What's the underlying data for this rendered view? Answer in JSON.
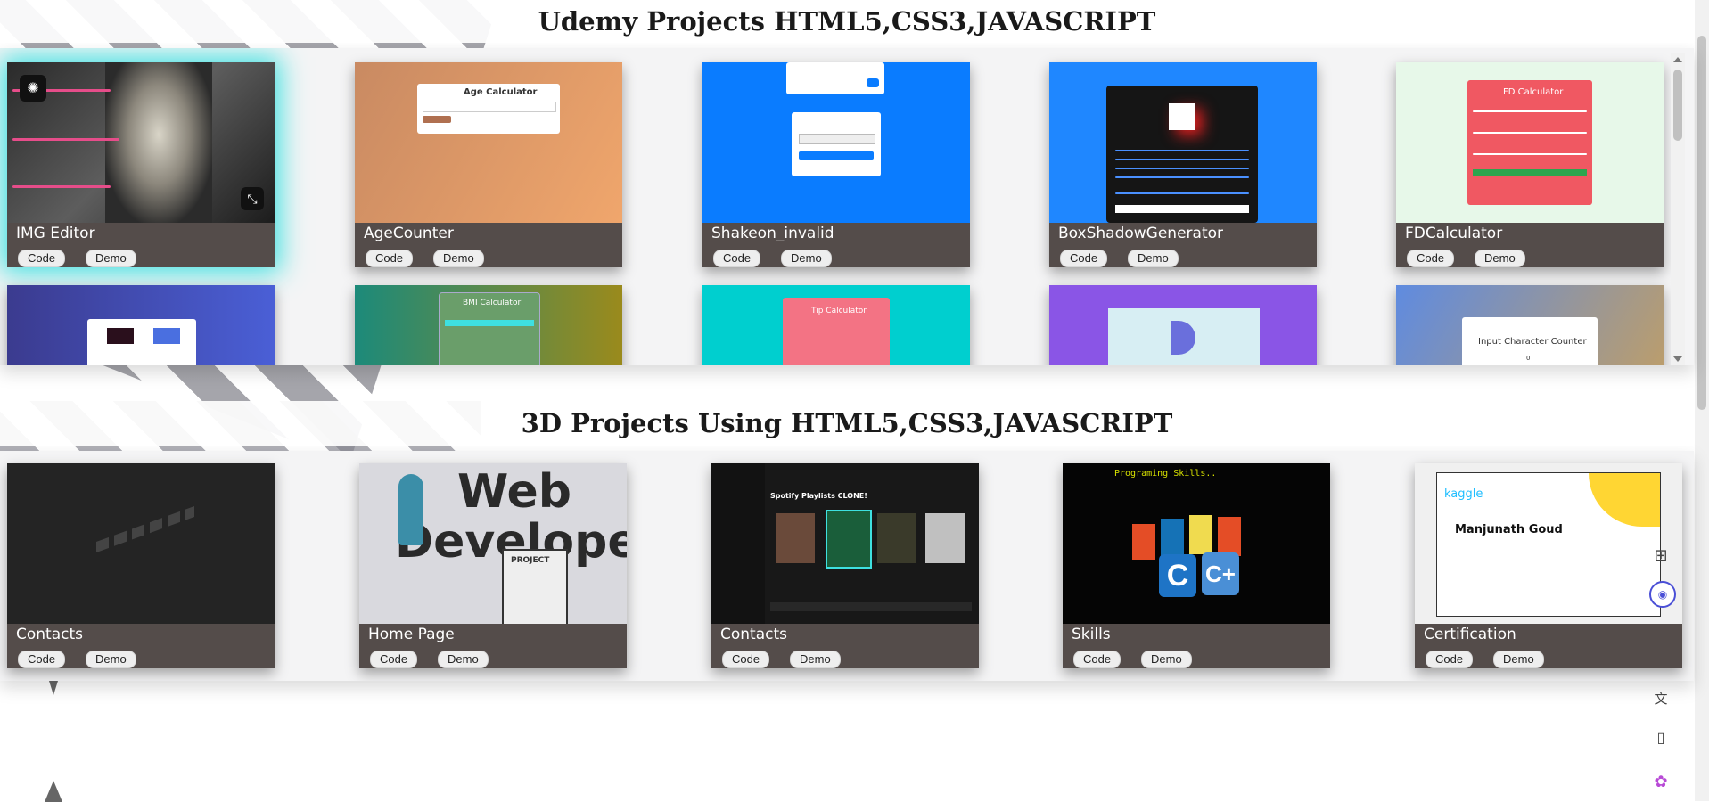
{
  "sections": [
    {
      "title": "Udemy Projects HTML5,CSS3,JAVASCRIPT",
      "cards": [
        {
          "title": "IMG Editor",
          "code": "Code",
          "demo": "Demo"
        },
        {
          "title": "AgeCounter",
          "code": "Code",
          "demo": "Demo",
          "inner_heading": "Age Calculator"
        },
        {
          "title": "Shakeon_invalid",
          "code": "Code",
          "demo": "Demo"
        },
        {
          "title": "BoxShadowGenerator",
          "code": "Code",
          "demo": "Demo"
        },
        {
          "title": "FDCalculator",
          "code": "Code",
          "demo": "Demo",
          "inner_heading": "FD Calculator"
        },
        {
          "title": "",
          "code": "",
          "demo": ""
        },
        {
          "title": "",
          "code": "",
          "demo": "",
          "inner_heading": "BMI Calculator"
        },
        {
          "title": "",
          "code": "",
          "demo": "",
          "inner_heading": "Tip Calculator"
        },
        {
          "title": "",
          "code": "",
          "demo": ""
        },
        {
          "title": "",
          "code": "",
          "demo": "",
          "inner_heading": "Input Character Counter",
          "inner_value": "0"
        }
      ]
    },
    {
      "title": "3D Projects Using HTML5,CSS3,JAVASCRIPT",
      "cards": [
        {
          "title": "Contacts",
          "code": "Code",
          "demo": "Demo"
        },
        {
          "title": "Home Page",
          "code": "Code",
          "demo": "Demo",
          "inner_text_1": "PROJECT"
        },
        {
          "title": "Contacts",
          "code": "Code",
          "demo": "Demo",
          "inner_heading": "Spotify Playlists CLONE!"
        },
        {
          "title": "Skills",
          "code": "Code",
          "demo": "Demo",
          "inner_heading": "Programing Skills.."
        },
        {
          "title": "Certification",
          "code": "Code",
          "demo": "Demo",
          "inner_heading": "kaggle",
          "inner_name": "Manjunath Goud"
        }
      ]
    }
  ],
  "colors": {
    "card_footer": "#544c4a",
    "accent_cyan": "#3ee0e0",
    "blue": "#0a7cff",
    "title_text": "#1a1a1a"
  },
  "icons": [
    "brain-icon",
    "crop-icon",
    "grid-icon",
    "chat-bot-icon",
    "translate-icon",
    "reader-icon",
    "ai-brain-icon"
  ]
}
